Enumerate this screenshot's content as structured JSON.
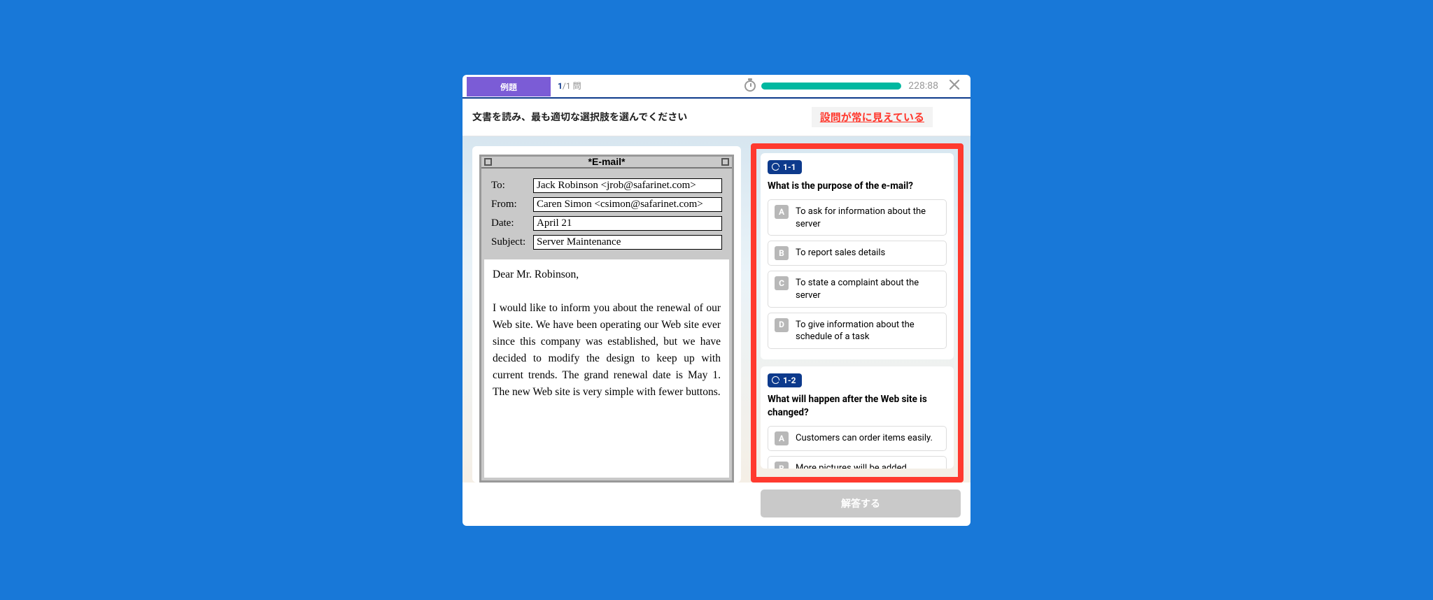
{
  "topbar": {
    "badge": "例題",
    "index": "1",
    "total": "/1",
    "unit": "問",
    "time": "228:88"
  },
  "instruction": "文書を読み、最も適切な選択肢を選んでください",
  "callout": "設問が常に見えている",
  "email": {
    "title": "*E-mail*",
    "labels": {
      "to": "To:",
      "from": "From:",
      "date": "Date:",
      "subject": "Subject:"
    },
    "to": "Jack Robinson <jrob@safarinet.com>",
    "from": "Caren Simon <csimon@safarinet.com>",
    "date": "April 21",
    "subject": "Server Maintenance",
    "greeting": "Dear Mr. Robinson,",
    "body": "I would like to inform you about the renewal of our Web site. We have been operating our Web site ever since this company was established, but we have decided to modify the design to keep up with current trends. The grand renewal date is May 1. The new Web site is very simple with fewer buttons."
  },
  "questions": [
    {
      "tag": "1-1",
      "stem": "What is the purpose of the e-mail?",
      "choices": [
        {
          "letter": "A",
          "text": "To ask for information about the server"
        },
        {
          "letter": "B",
          "text": "To report sales details"
        },
        {
          "letter": "C",
          "text": "To state a complaint about the server"
        },
        {
          "letter": "D",
          "text": "To give information about the schedule of a task"
        }
      ]
    },
    {
      "tag": "1-2",
      "stem": "What will happen after the Web site is changed?",
      "choices": [
        {
          "letter": "A",
          "text": "Customers can order items easily."
        },
        {
          "letter": "B",
          "text": "More pictures will be added."
        }
      ]
    }
  ],
  "submit": "解答する"
}
